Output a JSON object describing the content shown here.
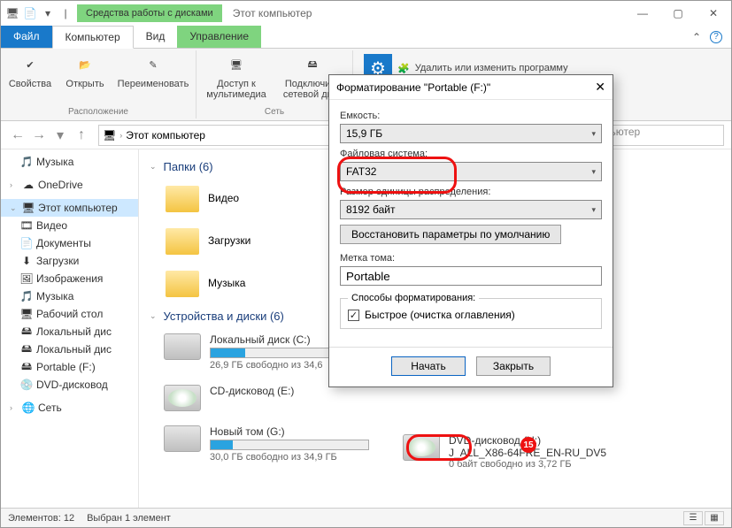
{
  "title": "Этот компьютер",
  "contextual_tab": "Средства работы с дисками",
  "tabs": {
    "file": "Файл",
    "computer": "Компьютер",
    "view": "Вид",
    "manage": "Управление"
  },
  "ribbon": {
    "props": "Свойства",
    "open": "Открыть",
    "rename": "Переименовать",
    "media": "Доступ к мультимедиа",
    "netdrive": "Подключить сетевой диск",
    "g_loc": "Расположение",
    "g_net": "Сеть",
    "remove": "Удалить или изменить программу"
  },
  "breadcrumb": "Этот компьютер",
  "search_placeholder": "пьютер",
  "tree": {
    "music": "Музыка",
    "onedrive": "OneDrive",
    "thispc": "Этот компьютер",
    "video": "Видео",
    "docs": "Документы",
    "downloads": "Загрузки",
    "pics": "Изображения",
    "music2": "Музыка",
    "desktop": "Рабочий стол",
    "localc": "Локальный дис",
    "localg": "Локальный дис",
    "portable": "Portable (F:)",
    "dvdg": "DVD-дисковод",
    "network": "Сеть"
  },
  "content": {
    "folders_hdr": "Папки (6)",
    "video": "Видео",
    "downloads": "Загрузки",
    "music": "Музыка",
    "drives_hdr": "Устройства и диски (6)",
    "d1": {
      "name": "Локальный диск (C:)",
      "free": "26,9 ГБ свободно из 34,6",
      "fill": 22
    },
    "d2": {
      "name": "CD-дисковод (E:)",
      "free": ""
    },
    "d3": {
      "name": "Новый том (G:)",
      "free": "30,0 ГБ свободно из 34,9 ГБ",
      "fill": 14
    },
    "d4": {
      "name": "DVD-дисковод (H:)\nJ_ALL_X86-64FRE_EN-RU_DV5",
      "free": "0 байт свободно из 3,72 ГБ"
    }
  },
  "status": {
    "items": "Элементов: 12",
    "sel": "Выбран 1 элемент"
  },
  "dialog": {
    "title": "Форматирование \"Portable (F:)\"",
    "capacity_lbl": "Емкость:",
    "capacity": "15,9 ГБ",
    "fs_lbl": "Файловая система:",
    "fs": "FAT32",
    "alloc_lbl": "Размер единицы распределения:",
    "alloc": "8192 байт",
    "restore": "Восстановить параметры по умолчанию",
    "label_lbl": "Метка тома:",
    "label": "Portable",
    "methods": "Способы форматирования:",
    "quick": "Быстрое (очистка оглавления)",
    "start": "Начать",
    "close": "Закрыть",
    "badge": "15"
  }
}
